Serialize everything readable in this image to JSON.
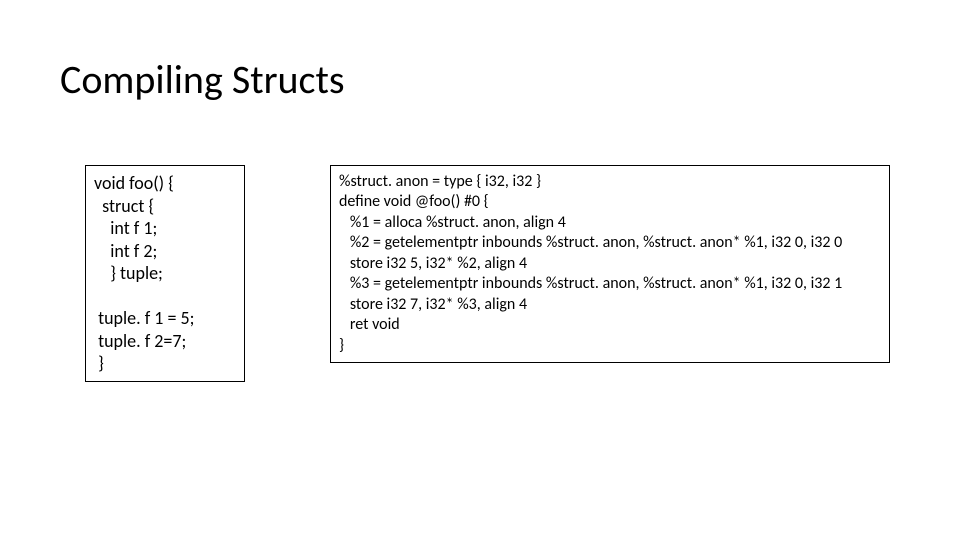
{
  "slide": {
    "title": "Compiling Structs",
    "left_code": "void foo() {\n  struct {\n    int f 1;\n    int f 2;\n    } tuple;\n\n tuple. f 1 = 5;\n tuple. f 2=7;\n }",
    "right_code": "%struct. anon = type { i32, i32 }\ndefine void @foo() #0 {\n   %1 = alloca %struct. anon, align 4\n   %2 = getelementptr inbounds %struct. anon, %struct. anon* %1, i32 0, i32 0\n   store i32 5, i32* %2, align 4\n   %3 = getelementptr inbounds %struct. anon, %struct. anon* %1, i32 0, i32 1\n   store i32 7, i32* %3, align 4\n   ret void\n}"
  }
}
